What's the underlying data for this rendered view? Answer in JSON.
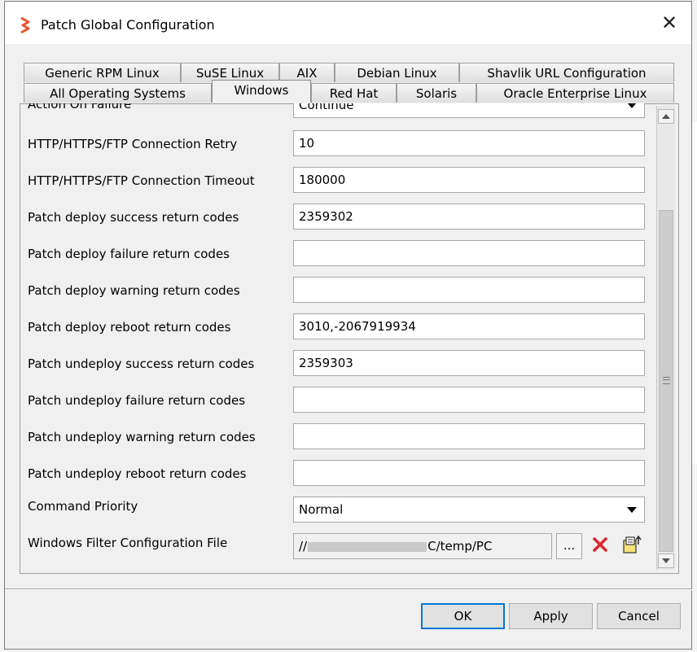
{
  "dialog": {
    "title": "Patch Global Configuration",
    "close_symbol": "✕"
  },
  "tabs_row1": [
    {
      "label": "Generic RPM Linux"
    },
    {
      "label": "SuSE Linux"
    },
    {
      "label": "AIX"
    },
    {
      "label": "Debian Linux"
    },
    {
      "label": "Shavlik URL Configuration"
    }
  ],
  "tabs_row2": [
    {
      "label": "All Operating Systems"
    },
    {
      "label": "Windows",
      "active": true
    },
    {
      "label": "Red Hat"
    },
    {
      "label": "Solaris"
    },
    {
      "label": "Oracle Enterprise Linux"
    }
  ],
  "form": {
    "partial_row": {
      "label": "Action On Failure",
      "value": "Continue"
    },
    "rows": [
      {
        "label": "HTTP/HTTPS/FTP Connection Retry",
        "value": "10"
      },
      {
        "label": "HTTP/HTTPS/FTP Connection Timeout",
        "value": "180000"
      },
      {
        "label": "Patch deploy success return codes",
        "value": "2359302"
      },
      {
        "label": "Patch deploy failure return codes",
        "value": ""
      },
      {
        "label": "Patch deploy warning return codes",
        "value": ""
      },
      {
        "label": "Patch deploy reboot return codes",
        "value": "3010,-2067919934"
      },
      {
        "label": "Patch undeploy success return codes",
        "value": "2359303"
      },
      {
        "label": "Patch undeploy failure return codes",
        "value": ""
      },
      {
        "label": "Patch undeploy warning return codes",
        "value": ""
      },
      {
        "label": "Patch undeploy reboot return codes",
        "value": ""
      }
    ],
    "command_priority": {
      "label": "Command Priority",
      "value": "Normal"
    },
    "filter_file": {
      "label": "Windows Filter Configuration File",
      "value_prefix": "//",
      "value_suffix": "C/temp/PC",
      "browse_label": "..."
    }
  },
  "buttons": {
    "ok": "OK",
    "apply": "Apply",
    "cancel": "Cancel"
  },
  "colors": {
    "accent": "#0078d7",
    "brand_icon": "#e8542a",
    "delete_icon": "#d9262c"
  }
}
